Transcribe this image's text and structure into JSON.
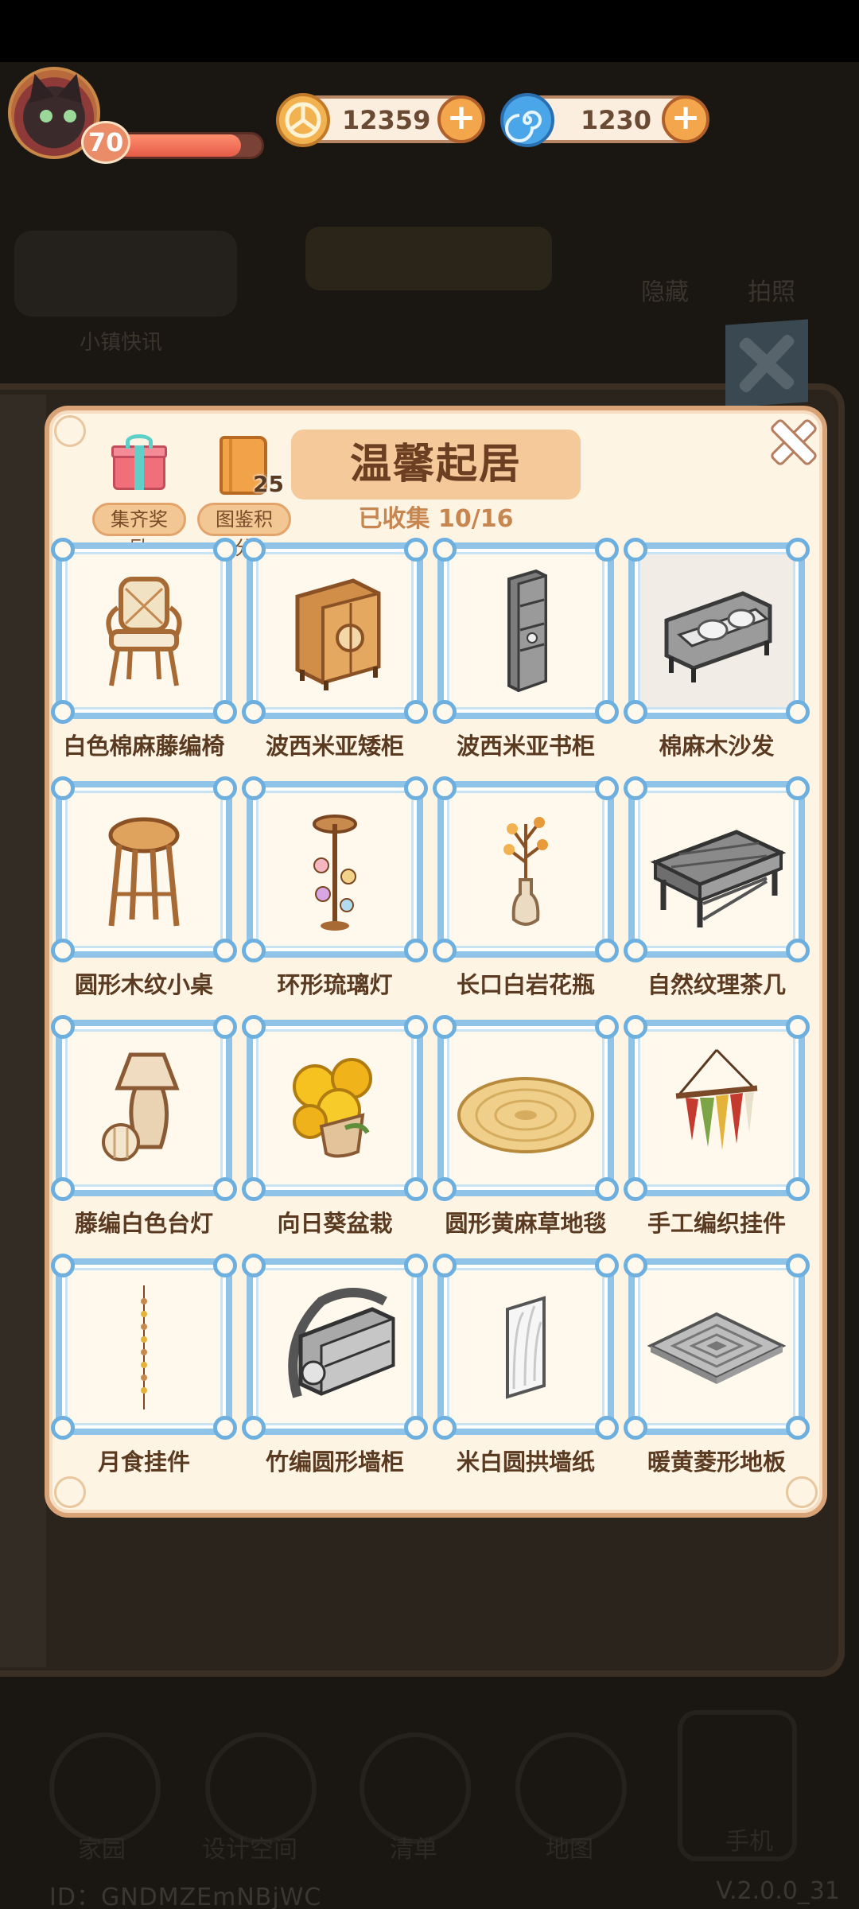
{
  "hud": {
    "level": "70",
    "level_progress": 0.88,
    "currency_gold": "12359",
    "currency_gem": "1230"
  },
  "panel": {
    "title": "温馨起居",
    "collected": "已收集 10/16",
    "gift_label": "集齐奖励",
    "book_label": "图鉴积分",
    "book_count": "25"
  },
  "items": [
    {
      "name": "白色棉麻藤编椅"
    },
    {
      "name": "波西米亚矮柜"
    },
    {
      "name": "波西米亚书柜"
    },
    {
      "name": "棉麻木沙发"
    },
    {
      "name": "圆形木纹小桌"
    },
    {
      "name": "环形琉璃灯"
    },
    {
      "name": "长口白岩花瓶"
    },
    {
      "name": "自然纹理茶几"
    },
    {
      "name": "藤编白色台灯"
    },
    {
      "name": "向日葵盆栽"
    },
    {
      "name": "圆形黄麻草地毯"
    },
    {
      "name": "手工编织挂件"
    },
    {
      "name": "月食挂件"
    },
    {
      "name": "竹编圆形墙柜"
    },
    {
      "name": "米白圆拱墙纸"
    },
    {
      "name": "暖黄菱形地板"
    }
  ],
  "background": {
    "left_banner_text": "小镇快讯",
    "hide_label": "隐藏",
    "photo_label": "拍照",
    "nav": [
      "家园",
      "设计空间",
      "清单",
      "地图",
      "手机"
    ],
    "id_text": "ID：GNDMZEmNBjWC",
    "version": "V.2.0.0_31"
  },
  "colors": {
    "frame_blue": "#8fc3e8",
    "panel_bg": "#fdf4e4",
    "title_bg": "#f6c99a",
    "accent_orange": "#f4a64d"
  }
}
